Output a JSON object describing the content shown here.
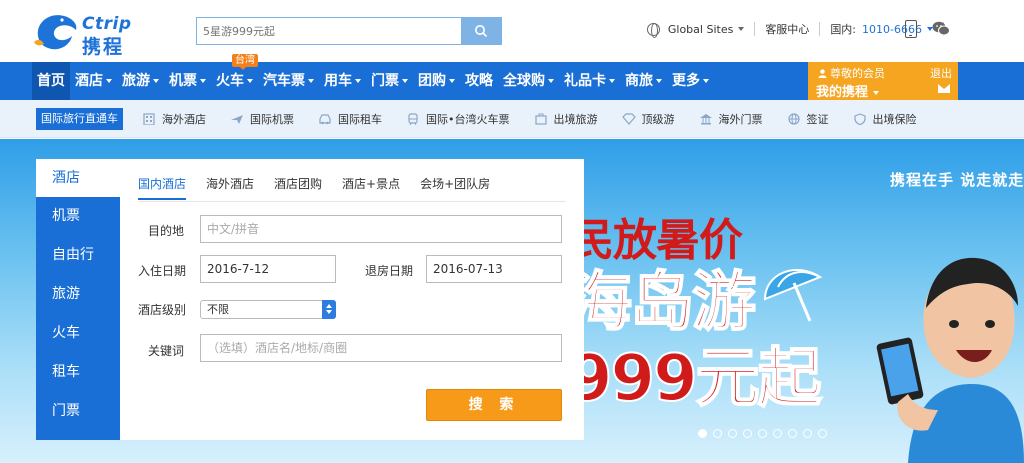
{
  "logo": {
    "brand_en": "Ctrip",
    "brand_zh": "携程"
  },
  "search": {
    "placeholder": "5星游999元起"
  },
  "top_links": {
    "global_sites": "Global Sites",
    "service_center": "客服中心",
    "domestic_label": "国内:",
    "domestic_phone": "1010-6666"
  },
  "main_nav": {
    "items": [
      {
        "label": "首页"
      },
      {
        "label": "酒店"
      },
      {
        "label": "旅游"
      },
      {
        "label": "机票"
      },
      {
        "label": "火车",
        "badge": "台湾"
      },
      {
        "label": "汽车票"
      },
      {
        "label": "用车"
      },
      {
        "label": "门票"
      },
      {
        "label": "团购"
      },
      {
        "label": "攻略"
      },
      {
        "label": "全球购"
      },
      {
        "label": "礼品卡"
      },
      {
        "label": "商旅"
      },
      {
        "label": "更多"
      }
    ]
  },
  "member": {
    "greeting": "尊敬的会员",
    "my_ctrip": "我的携程",
    "logout": "退出"
  },
  "sub_nav": {
    "label": "国际旅行直通车",
    "items": [
      {
        "label": "海外酒店"
      },
      {
        "label": "国际机票"
      },
      {
        "label": "国际租车"
      },
      {
        "label": "国际•台湾火车票"
      },
      {
        "label": "出境旅游"
      },
      {
        "label": "顶级游"
      },
      {
        "label": "海外门票"
      },
      {
        "label": "签证"
      },
      {
        "label": "出境保险"
      }
    ]
  },
  "vertical_tabs": [
    "酒店",
    "机票",
    "自由行",
    "旅游",
    "火车",
    "租车",
    "门票"
  ],
  "hotel_tabs": [
    "国内酒店",
    "海外酒店",
    "酒店团购",
    "酒店+景点",
    "会场+团队房"
  ],
  "form": {
    "destination_label": "目的地",
    "destination_placeholder": "中文/拼音",
    "checkin_label": "入住日期",
    "checkin_value": "2016-7-12",
    "checkout_label": "退房日期",
    "checkout_value": "2016-07-13",
    "level_label": "酒店级别",
    "level_value": "不限",
    "keyword_label": "关键词",
    "keyword_placeholder": "（选填）酒店名/地标/商圈",
    "submit_label": "搜 索"
  },
  "banner": {
    "slogan": "携程在手 说走就走",
    "promo_line1": "民放暑价",
    "promo_line2": "海岛游",
    "promo_line3": "999元起",
    "slide_count": 9,
    "active_slide": 1
  },
  "colors": {
    "brand_blue": "#1a6fd6",
    "accent_orange": "#f79a1a",
    "member_orange": "#f6a521"
  }
}
